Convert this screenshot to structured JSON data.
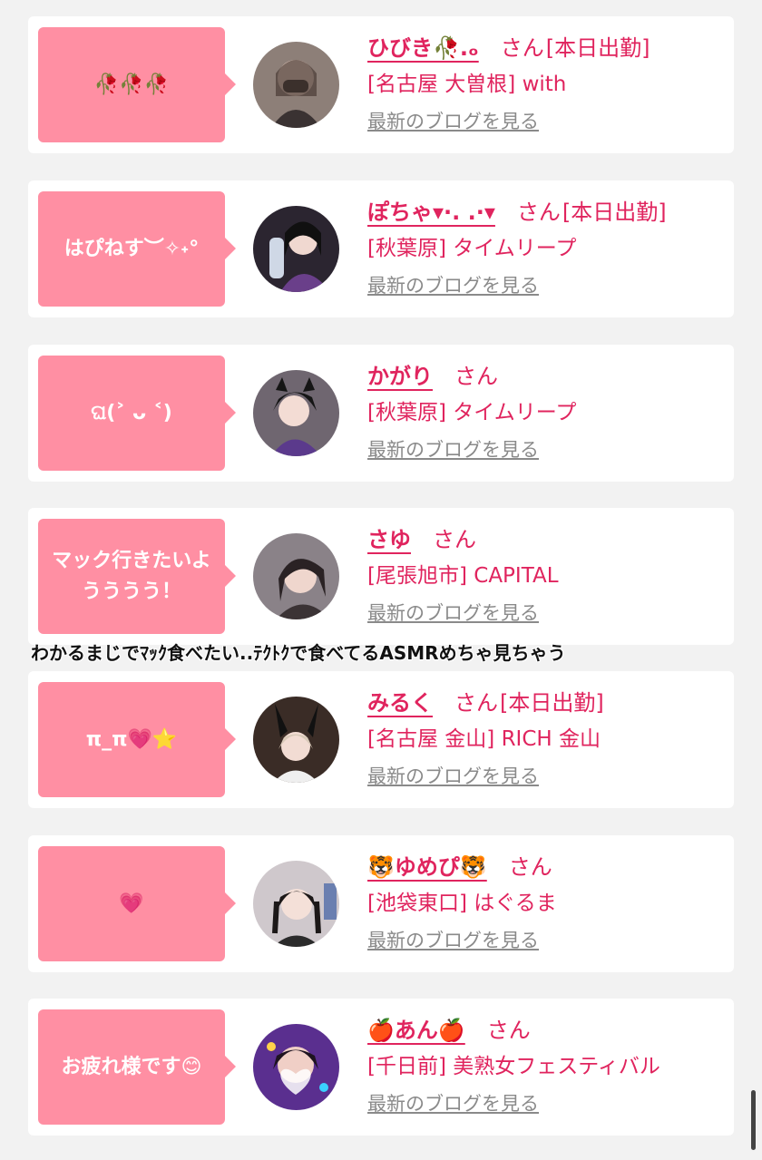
{
  "cards": [
    {
      "bubble": "🥀🥀🥀",
      "name": "ひびき🥀.ₒ",
      "san": "さん",
      "status": "[本日出勤]",
      "shop": "[名古屋 大曽根] with",
      "blog": "最新のブログを見る"
    },
    {
      "bubble": "はぴねす︶✧˖°",
      "name": "ぽちゃ▾·. .·▾",
      "san": "さん",
      "status": "[本日出勤]",
      "shop": "[秋葉原] タイムリープ",
      "blog": "最新のブログを見る"
    },
    {
      "bubble": "ଘ(˃ ᴗ ˂)",
      "name": "かがり",
      "san": "さん",
      "status": "",
      "shop": "[秋葉原] タイムリープ",
      "blog": "最新のブログを見る"
    },
    {
      "bubble": "マック行きたいようううう！",
      "name": "さゆ",
      "san": "さん",
      "status": "",
      "shop": "[尾張旭市] CAPITAL",
      "blog": "最新のブログを見る"
    },
    {
      "bubble": "π_π💗⭐",
      "name": "みるく",
      "san": "さん",
      "status": "[本日出勤]",
      "shop": "[名古屋 金山] RICH 金山",
      "blog": "最新のブログを見る"
    },
    {
      "bubble": "💗",
      "name": "🐯ゆめぴ🐯",
      "san": "さん",
      "status": "",
      "shop": "[池袋東口] はぐるま",
      "blog": "最新のブログを見る"
    },
    {
      "bubble": "お疲れ様です😊",
      "name": "🍎あん🍎",
      "san": "さん",
      "status": "",
      "shop": "[千日前] 美熟女フェスティバル",
      "blog": "最新のブログを見る"
    }
  ],
  "overlay_caption": "わかるまじでﾏｯｸ食べたい..ﾃｸﾄｸで食べてるASMRめちゃ見ちゃう",
  "colors": {
    "accent": "#e0245e",
    "bubble": "#ff8fa3",
    "link_gray": "#8a8a8a",
    "background": "#f2f2f2"
  }
}
